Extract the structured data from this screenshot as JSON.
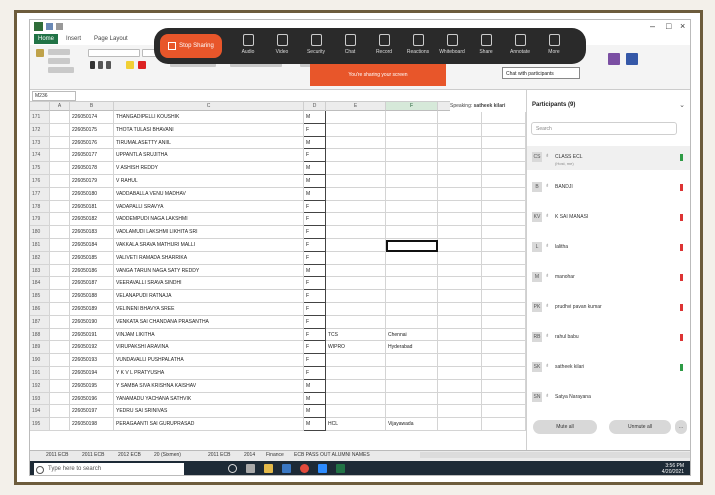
{
  "excel": {
    "tabs": [
      "Home",
      "Insert",
      "Page Layout"
    ],
    "name_box": "M236",
    "columns": [
      "A",
      "B",
      "C",
      "D",
      "E",
      "F",
      "G",
      "H",
      "I",
      "J",
      "K"
    ],
    "rows": [
      {
        "n": "171",
        "id": "226050174",
        "name": "THANGADIPELLI KOUSHIK",
        "g": "M",
        "e": "",
        "f": ""
      },
      {
        "n": "172",
        "id": "226050175",
        "name": "THOTA TULASI BHAVANI",
        "g": "F",
        "e": "",
        "f": ""
      },
      {
        "n": "173",
        "id": "226050176",
        "name": "TIRUMALASETTY ANIIL",
        "g": "M",
        "e": "",
        "f": ""
      },
      {
        "n": "174",
        "id": "226050177",
        "name": "UPPANTLA SRUJITHA",
        "g": "F",
        "e": "",
        "f": ""
      },
      {
        "n": "175",
        "id": "226050178",
        "name": "V ASHISH REDDY",
        "g": "M",
        "e": "",
        "f": ""
      },
      {
        "n": "176",
        "id": "226050179",
        "name": "V RAHUL",
        "g": "M",
        "e": "",
        "f": ""
      },
      {
        "n": "177",
        "id": "226050180",
        "name": "VADDABALLA VENU MADHAV",
        "g": "M",
        "e": "",
        "f": ""
      },
      {
        "n": "178",
        "id": "226050181",
        "name": "VADAPALLI SRAVYA",
        "g": "F",
        "e": "",
        "f": ""
      },
      {
        "n": "179",
        "id": "226050182",
        "name": "VADDEMPUDI NAGA LAKSHMI",
        "g": "F",
        "e": "",
        "f": ""
      },
      {
        "n": "180",
        "id": "226050183",
        "name": "VADLAMUDI LAKSHMI LIKHITA SRI",
        "g": "F",
        "e": "",
        "f": ""
      },
      {
        "n": "181",
        "id": "226050184",
        "name": "VAKKALA SRAVA MATHURI MALLI",
        "g": "F",
        "e": "",
        "f": ""
      },
      {
        "n": "182",
        "id": "226050185",
        "name": "VALIVETI RAMADA SHARRIKA",
        "g": "F",
        "e": "",
        "f": ""
      },
      {
        "n": "183",
        "id": "226050186",
        "name": "VANGA TARUN NAGA SATY REDDY",
        "g": "M",
        "e": "",
        "f": ""
      },
      {
        "n": "184",
        "id": "226050187",
        "name": "VEERAVALLI SRAVA SINDHI",
        "g": "F",
        "e": "",
        "f": ""
      },
      {
        "n": "185",
        "id": "226050188",
        "name": "VELANAPUDI RATNAJA",
        "g": "F",
        "e": "",
        "f": ""
      },
      {
        "n": "186",
        "id": "226050189",
        "name": "VELINENI BHAVYA SREE",
        "g": "F",
        "e": "",
        "f": ""
      },
      {
        "n": "187",
        "id": "226050190",
        "name": "VENKATA SAI CHANDANA PRASANTHA",
        "g": "F",
        "e": "",
        "f": ""
      },
      {
        "n": "188",
        "id": "226050191",
        "name": "VINJAM LIKITHA",
        "g": "F",
        "e": "TCS",
        "f": "Chennai"
      },
      {
        "n": "189",
        "id": "226050192",
        "name": "VIRUPAKSHI ARAVINA",
        "g": "F",
        "e": "WIPRO",
        "f": "Hyderabad"
      },
      {
        "n": "190",
        "id": "226050193",
        "name": "VUNDAVALLI PUSHPALATHA",
        "g": "F",
        "e": "",
        "f": ""
      },
      {
        "n": "191",
        "id": "226050194",
        "name": "Y K V L PRATYUSHA",
        "g": "F",
        "e": "",
        "f": ""
      },
      {
        "n": "192",
        "id": "226050195",
        "name": "Y SAMBA SIVA KRISHNA KAISHAV",
        "g": "M",
        "e": "",
        "f": ""
      },
      {
        "n": "193",
        "id": "226050196",
        "name": "YANAMADU YACHANA SATHVIK",
        "g": "M",
        "e": "",
        "f": ""
      },
      {
        "n": "194",
        "id": "226050197",
        "name": "YEDRU SAI SRINIVAS",
        "g": "M",
        "e": "",
        "f": ""
      },
      {
        "n": "195",
        "id": "226050198",
        "name": "PERAGAANTI SAI GURUPRASAD",
        "g": "M",
        "e": "HCL",
        "f": "Vijayawada"
      }
    ],
    "sheet_tabs": [
      "2011 ECB",
      "2011 ECB",
      "2012 ECB",
      "20 (Sixmen)",
      "2011 ECB",
      "2014",
      "Finance",
      "ECB PASS OUT ALUMNI NAMES"
    ]
  },
  "zoom": {
    "stop_share": "Stop Sharing",
    "items": [
      "Audio",
      "Video",
      "Security",
      "Chat",
      "Record",
      "Reactions",
      "Whiteboard",
      "Share",
      "Annotate",
      "More"
    ],
    "banner": "You're sharing your screen",
    "tooltip": "Chat with participants",
    "speaking_label": "Speaking:",
    "speaking_name": "satheek kilari"
  },
  "participants": {
    "title": "Participants (9)",
    "search_placeholder": "Search",
    "list": [
      {
        "initials": "CS",
        "name": "CLASS ECL",
        "sub": "(Host, me)",
        "status": "#2e9b45"
      },
      {
        "initials": "B",
        "name": "BANDJI",
        "sub": "",
        "status": "#d33"
      },
      {
        "initials": "KV",
        "name": "K SAI MANASI",
        "sub": "",
        "status": "#d33"
      },
      {
        "initials": "L",
        "name": "lalitha",
        "sub": "",
        "status": "#d33"
      },
      {
        "initials": "M",
        "name": "manohar",
        "sub": "",
        "status": "#d33"
      },
      {
        "initials": "PK",
        "name": "prudhvi pavan kumar",
        "sub": "",
        "status": "#d33"
      },
      {
        "initials": "RB",
        "name": "rahul babu",
        "sub": "",
        "status": "#d33"
      },
      {
        "initials": "SK",
        "name": "satheek kilari",
        "sub": "",
        "status": "#2e9b45"
      },
      {
        "initials": "SN",
        "name": "Satya Narayana",
        "sub": "",
        "status": ""
      }
    ],
    "mute_all": "Mute all",
    "unmute_all": "Unmute all"
  },
  "taskbar": {
    "search_placeholder": "Type here to search",
    "time": "3:56 PM",
    "date": "4/20/2021"
  }
}
